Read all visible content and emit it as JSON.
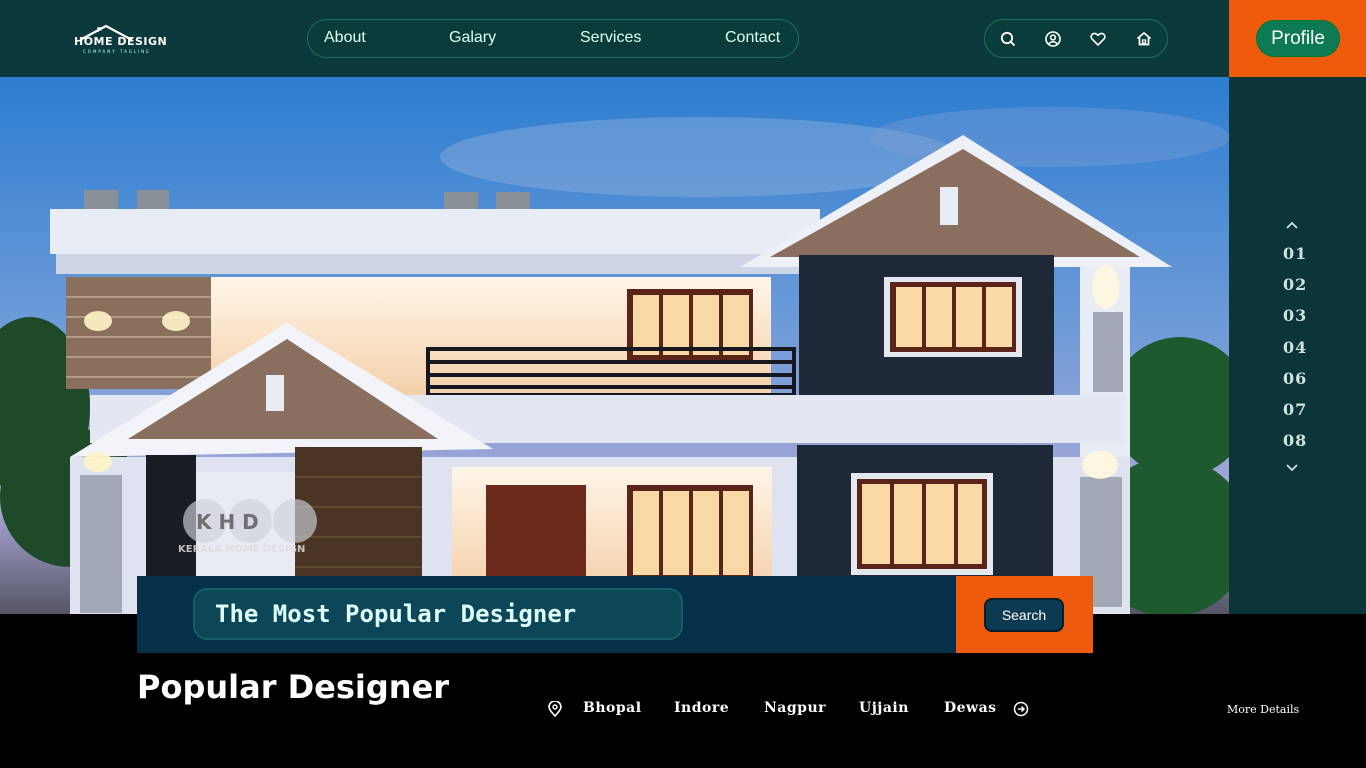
{
  "logo": {
    "text": "HOME DESIGN",
    "tagline": "COMPANY TAGLINE"
  },
  "nav": {
    "items": [
      "About",
      "Galary",
      "Services",
      "Contact"
    ]
  },
  "header_icons": [
    "search-icon",
    "user-icon",
    "heart-icon",
    "home-icon"
  ],
  "profile": {
    "label": "Profile"
  },
  "side_pager": {
    "numbers": [
      "01",
      "02",
      "03",
      "04",
      "06",
      "07",
      "08"
    ]
  },
  "hero": {
    "watermark": "KHD",
    "watermark_sub": "KERALA HOME DESIGN"
  },
  "search": {
    "value": "The Most Popular Designer",
    "button": "Search"
  },
  "popular": {
    "title": "Popular Designer",
    "cities": [
      "Bhopal",
      "Indore",
      "Nagpur",
      "Ujjain",
      "Dewas"
    ],
    "more": "More Details"
  },
  "colors": {
    "accent": "#ef5b0c",
    "header_bg": "#0c3a3c",
    "pill_bg": "#0a3d3a",
    "profile_btn": "#0c7a52"
  }
}
